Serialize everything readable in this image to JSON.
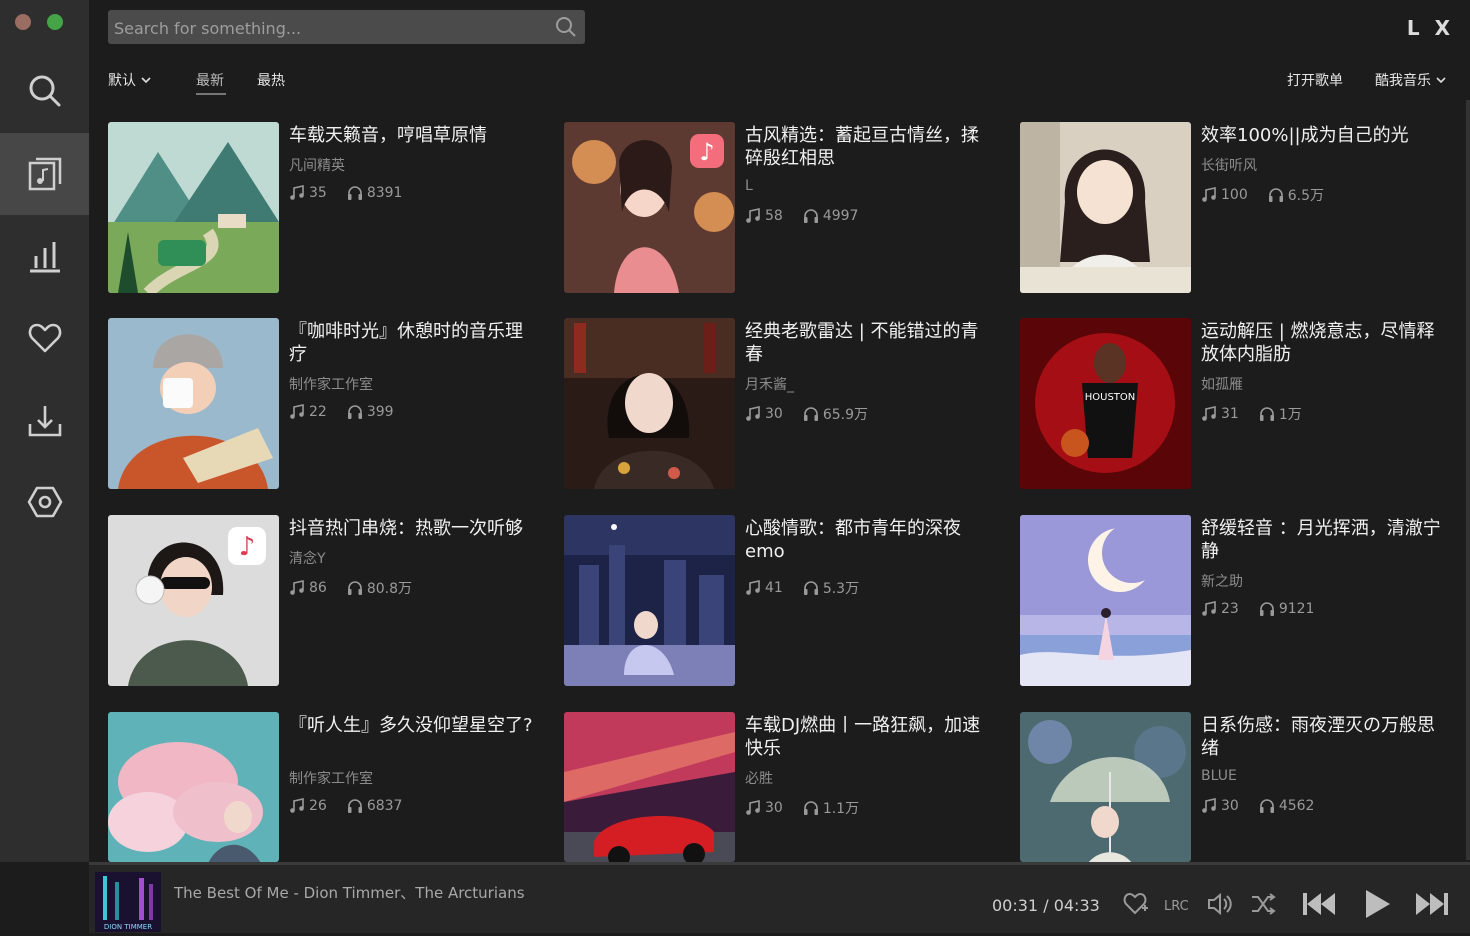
{
  "search": {
    "placeholder": "Search for something..."
  },
  "brand": "L X",
  "filters": {
    "sort_label": "默认",
    "tabs": [
      "最新",
      "最热"
    ],
    "open_playlist": "打开歌单",
    "source": "酷我音乐"
  },
  "playlists": [
    {
      "title": "车载天籁音，哼唱草原情",
      "author": "凡间精英",
      "songs": "35",
      "plays": "8391",
      "cover": "mountain-bus"
    },
    {
      "title": "古风精选：蓄起亘古情丝，揉碎殷红相思",
      "author": "L",
      "songs": "58",
      "plays": "4997",
      "cover": "guofeng-girl"
    },
    {
      "title": "效率100%||成为自己的光",
      "author": "长街听风",
      "songs": "100",
      "plays": "6.5万",
      "cover": "study-girl"
    },
    {
      "title": "『咖啡时光』休憩时的音乐理疗",
      "author": "制作家工作室",
      "songs": "22",
      "plays": "399",
      "cover": "coffee-girl"
    },
    {
      "title": "经典老歌雷达 | 不能错过的青春",
      "author": "月禾酱_",
      "songs": "30",
      "plays": "65.9万",
      "cover": "bar-girl"
    },
    {
      "title": "运动解压 | 燃烧意志，尽情释放体内脂肪",
      "author": "如孤雁",
      "songs": "31",
      "plays": "1万",
      "cover": "basketball"
    },
    {
      "title": "抖音热门串烧：热歌一次听够",
      "author": "清念Y",
      "songs": "86",
      "plays": "80.8万",
      "cover": "headphone-girl"
    },
    {
      "title": "心酸情歌：都市青年的深夜emo",
      "author": "",
      "songs": "41",
      "plays": "5.3万",
      "cover": "city-night"
    },
    {
      "title": "舒缓轻音 ：月光挥洒，清澈宁静",
      "author": "新之助",
      "songs": "23",
      "plays": "9121",
      "cover": "moon-sea"
    },
    {
      "title": "『听人生』多久没仰望星空了?",
      "author": "制作家工作室",
      "songs": "26",
      "plays": "6837",
      "cover": "pink-cloud"
    },
    {
      "title": "车载DJ燃曲丨一路狂飙，加速快乐",
      "author": "必胜",
      "songs": "30",
      "plays": "1.1万",
      "cover": "red-car"
    },
    {
      "title": "日系伤感：雨夜湮灭の万般思绪",
      "author": "BLUE",
      "songs": "30",
      "plays": "4562",
      "cover": "umbrella-girl"
    }
  ],
  "player": {
    "track": "The Best Of Me - Dion Timmer、The Arcturians",
    "current_time": "00:31",
    "separator": "/",
    "duration": "04:33",
    "cover_text": "DION TIMMER"
  }
}
